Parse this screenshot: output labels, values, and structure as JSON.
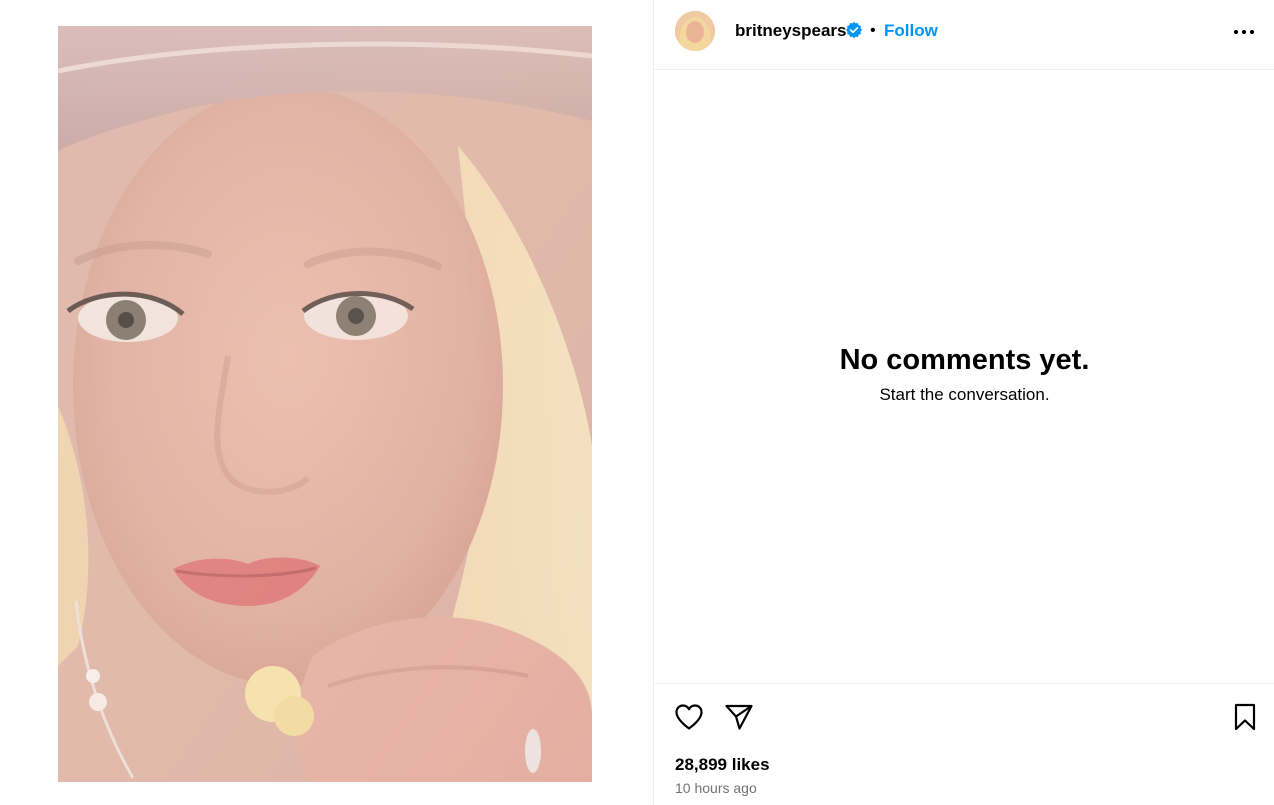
{
  "post": {
    "media_alt": "photo",
    "author": {
      "username": "britneyspears",
      "verified": true,
      "follow_label": "Follow",
      "separator": "•"
    }
  },
  "comments": {
    "empty_title": "No comments yet.",
    "empty_subtitle": "Start the conversation."
  },
  "stats": {
    "likes": "28,899 likes",
    "posted": "10 hours ago"
  },
  "icons": {
    "more": "more-options-icon",
    "like": "heart-icon",
    "share": "share-send-icon",
    "save": "bookmark-icon",
    "verified": "verified-badge-icon"
  },
  "colors": {
    "follow": "#0095f6",
    "verified": "#0095f6",
    "muted": "#737373",
    "divider": "#efefef"
  }
}
